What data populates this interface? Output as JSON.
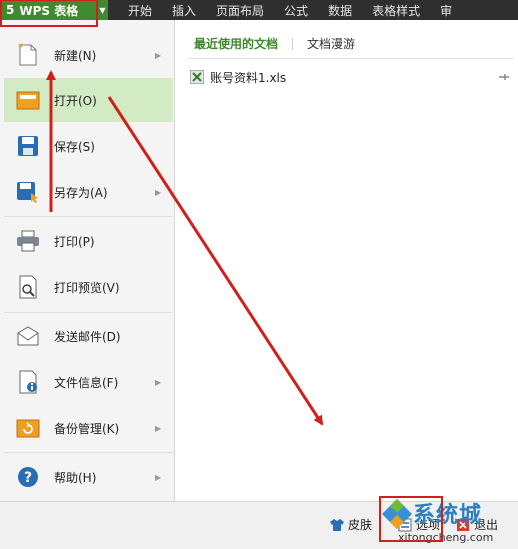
{
  "app": {
    "title": "WPS 表格",
    "logo_glyph": "5"
  },
  "ribbon_tabs": [
    "开始",
    "插入",
    "页面布局",
    "公式",
    "数据",
    "表格样式",
    "审"
  ],
  "menu_items": [
    {
      "label": "新建(N)",
      "icon": "new-file-icon",
      "has_submenu": true
    },
    {
      "label": "打开(O)",
      "icon": "open-folder-icon",
      "has_submenu": false,
      "active": true
    },
    {
      "label": "保存(S)",
      "icon": "save-disk-icon",
      "has_submenu": false
    },
    {
      "label": "另存为(A)",
      "icon": "save-as-icon",
      "has_submenu": true
    },
    {
      "label": "打印(P)",
      "icon": "printer-icon",
      "has_submenu": false
    },
    {
      "label": "打印预览(V)",
      "icon": "print-preview-icon",
      "has_submenu": false
    },
    {
      "label": "发送邮件(D)",
      "icon": "mail-icon",
      "has_submenu": false
    },
    {
      "label": "文件信息(F)",
      "icon": "file-info-icon",
      "has_submenu": true
    },
    {
      "label": "备份管理(K)",
      "icon": "backup-icon",
      "has_submenu": true
    },
    {
      "label": "帮助(H)",
      "icon": "help-icon",
      "has_submenu": true
    }
  ],
  "panel": {
    "tabs": [
      "最近使用的文档",
      "文档漫游"
    ],
    "recent_files": [
      {
        "name": "账号资料1.xls",
        "icon": "excel-file-icon"
      }
    ]
  },
  "bottom": {
    "skin_label": "皮肤",
    "options_label": "选项",
    "exit_label": "退出"
  },
  "watermark": {
    "brand": "系统城",
    "url": "xitongcheng.com"
  },
  "colors": {
    "accent_green": "#3f8a2e",
    "active_row": "#d2ebc4",
    "annotation_red": "#d0201a"
  }
}
